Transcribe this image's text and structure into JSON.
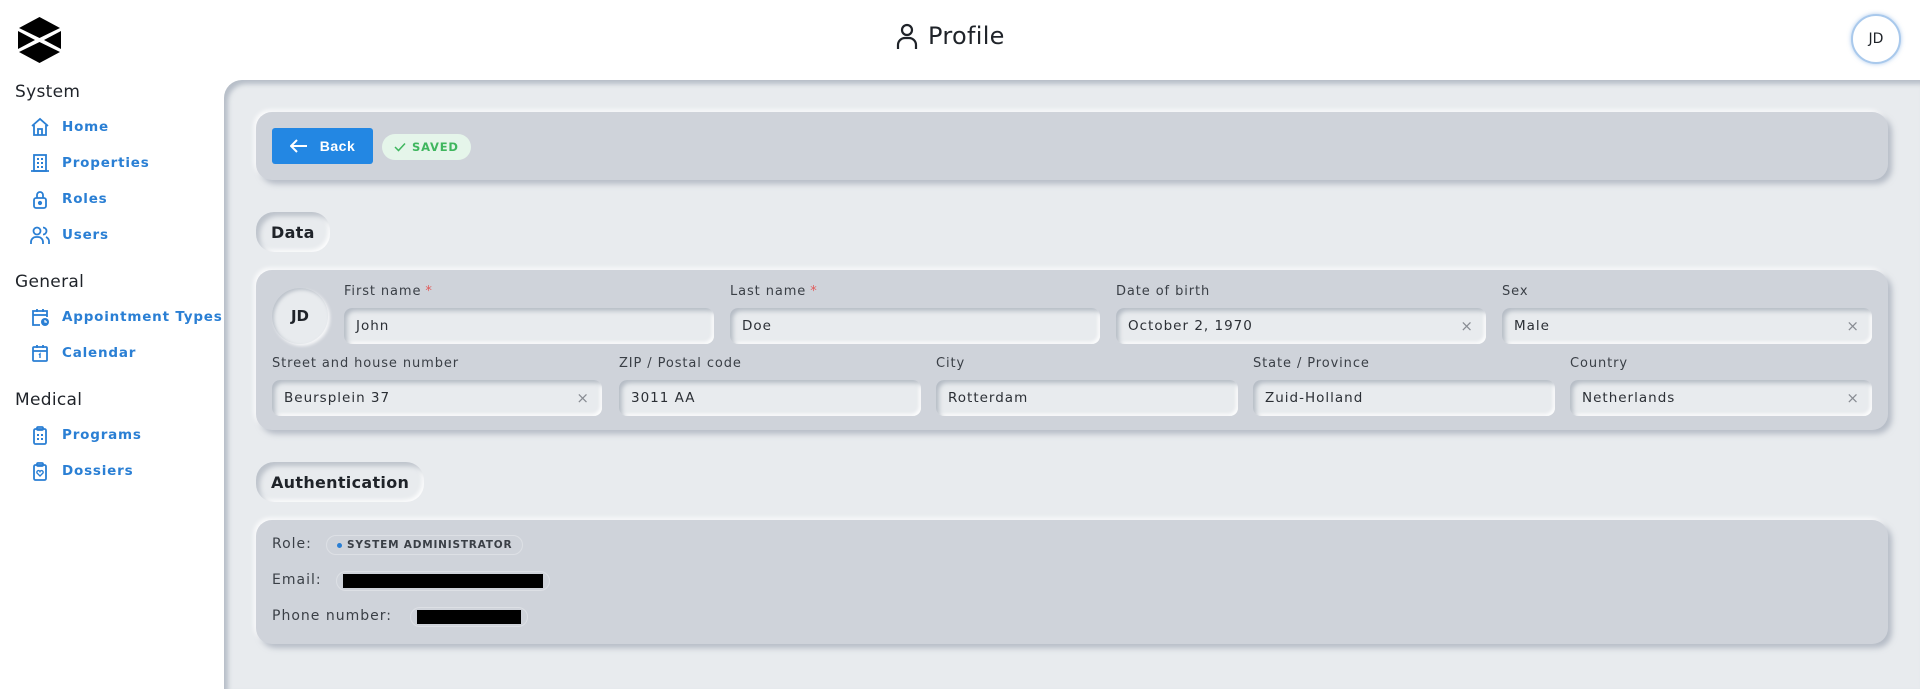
{
  "header": {
    "title": "Profile",
    "title_icon": "user-icon",
    "logo_icon": "hexagon-x-logo",
    "avatar_initials": "JD"
  },
  "sidebar": {
    "sections": [
      {
        "title": "System",
        "items": [
          {
            "label": "Home",
            "icon": "home-icon"
          },
          {
            "label": "Properties",
            "icon": "building-icon"
          },
          {
            "label": "Roles",
            "icon": "lock-icon"
          },
          {
            "label": "Users",
            "icon": "users-icon"
          }
        ]
      },
      {
        "title": "General",
        "items": [
          {
            "label": "Appointment Types",
            "icon": "calendar-clock-icon"
          },
          {
            "label": "Calendar",
            "icon": "calendar-icon"
          }
        ]
      },
      {
        "title": "Medical",
        "items": [
          {
            "label": "Programs",
            "icon": "clipboard-list-icon"
          },
          {
            "label": "Dossiers",
            "icon": "clipboard-heart-icon"
          }
        ]
      }
    ]
  },
  "toolbar": {
    "back_label": "Back",
    "saved_label": "SAVED"
  },
  "data_section": {
    "title": "Data",
    "avatar_initials": "JD",
    "fields": {
      "first_name": {
        "label": "First name",
        "required": "*",
        "value": "John"
      },
      "last_name": {
        "label": "Last name",
        "required": "*",
        "value": "Doe"
      },
      "date_of_birth": {
        "label": "Date of birth",
        "value": "October 2, 1970",
        "clearable": true
      },
      "sex": {
        "label": "Sex",
        "value": "Male",
        "clearable": true
      },
      "street": {
        "label": "Street and house number",
        "value": "Beursplein 37",
        "clearable": true
      },
      "zip": {
        "label": "ZIP / Postal code",
        "value": "3011 AA"
      },
      "city": {
        "label": "City",
        "value": "Rotterdam"
      },
      "state": {
        "label": "State / Province",
        "value": "Zuid-Holland"
      },
      "country": {
        "label": "Country",
        "value": "Netherlands",
        "clearable": true
      }
    },
    "clear_glyph": "×"
  },
  "auth_section": {
    "title": "Authentication",
    "role_label": "Role:",
    "role_value": "SYSTEM ADMINISTRATOR",
    "email_label": "Email:",
    "email_value": "[redacted]",
    "phone_label": "Phone number:",
    "phone_value": "[redacted]"
  },
  "colors": {
    "accent": "#2387e3",
    "sidebar_link": "#2a7fd4",
    "saved_text": "#3fb65e",
    "saved_bg": "#e5f5ea",
    "required": "#e25a5a",
    "panel": "#cfd3da",
    "background": "#e8ebee"
  }
}
